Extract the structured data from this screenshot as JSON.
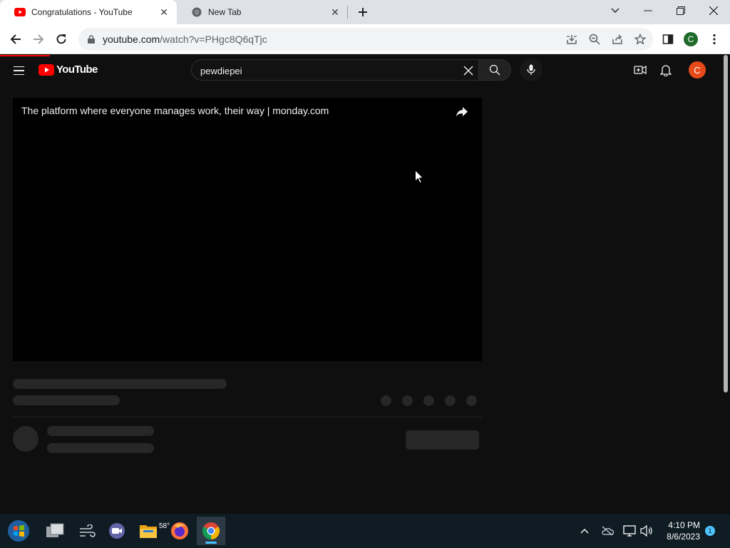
{
  "browser": {
    "tabs": [
      {
        "title": "Congratulations - YouTube",
        "active": true
      },
      {
        "title": "New Tab",
        "active": false
      }
    ],
    "url": {
      "host": "youtube.com",
      "path": "/watch?v=PHgc8Q6qTjc"
    },
    "profile_initial": "C"
  },
  "youtube": {
    "logo_text": "YouTube",
    "search": {
      "value": "pewdiepei"
    },
    "avatar_initial": "C",
    "player": {
      "title": "The platform where everyone manages work, their way | monday.com"
    },
    "accent_color": "#ff0000"
  },
  "taskbar": {
    "weather_temp": "58°",
    "time": "4:10 PM",
    "date": "8/6/2023",
    "notification_count": "1"
  }
}
